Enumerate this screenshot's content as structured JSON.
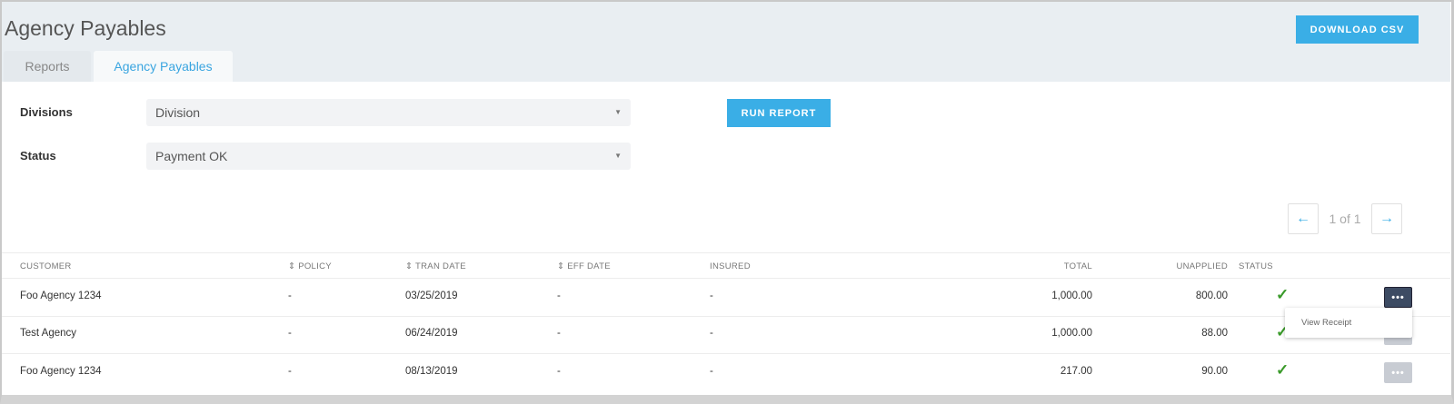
{
  "header": {
    "title": "Agency Payables",
    "download_label": "DOWNLOAD CSV"
  },
  "tabs": [
    {
      "label": "Reports"
    },
    {
      "label": "Agency Payables"
    }
  ],
  "filters": {
    "divisions_label": "Divisions",
    "divisions_value": "Division",
    "status_label": "Status",
    "status_value": "Payment OK",
    "run_label": "RUN REPORT"
  },
  "pagination": {
    "text": "1 of 1",
    "prev": "←",
    "next": "→"
  },
  "table": {
    "columns": [
      "CUSTOMER",
      "POLICY",
      "TRAN DATE",
      "EFF DATE",
      "INSURED",
      "TOTAL",
      "UNAPPLIED",
      "STATUS"
    ],
    "sort_icon": "⇕",
    "rows": [
      {
        "customer": "Foo Agency 1234",
        "policy": "-",
        "tran_date": "03/25/2019",
        "eff_date": "-",
        "insured": "-",
        "total": "1,000.00",
        "unapplied": "800.00",
        "status": "✓"
      },
      {
        "customer": "Test Agency",
        "policy": "-",
        "tran_date": "06/24/2019",
        "eff_date": "-",
        "insured": "-",
        "total": "1,000.00",
        "unapplied": "88.00",
        "status": "✓"
      },
      {
        "customer": "Foo Agency 1234",
        "policy": "-",
        "tran_date": "08/13/2019",
        "eff_date": "-",
        "insured": "-",
        "total": "217.00",
        "unapplied": "90.00",
        "status": "✓"
      }
    ],
    "more_label": "•••"
  },
  "menu": {
    "view_receipt": "View Receipt"
  },
  "colors": {
    "accent": "#3aaee6",
    "active_more": "#3d4b63",
    "inactive_more": "#c8ccd3",
    "check": "#3a9a2a"
  }
}
